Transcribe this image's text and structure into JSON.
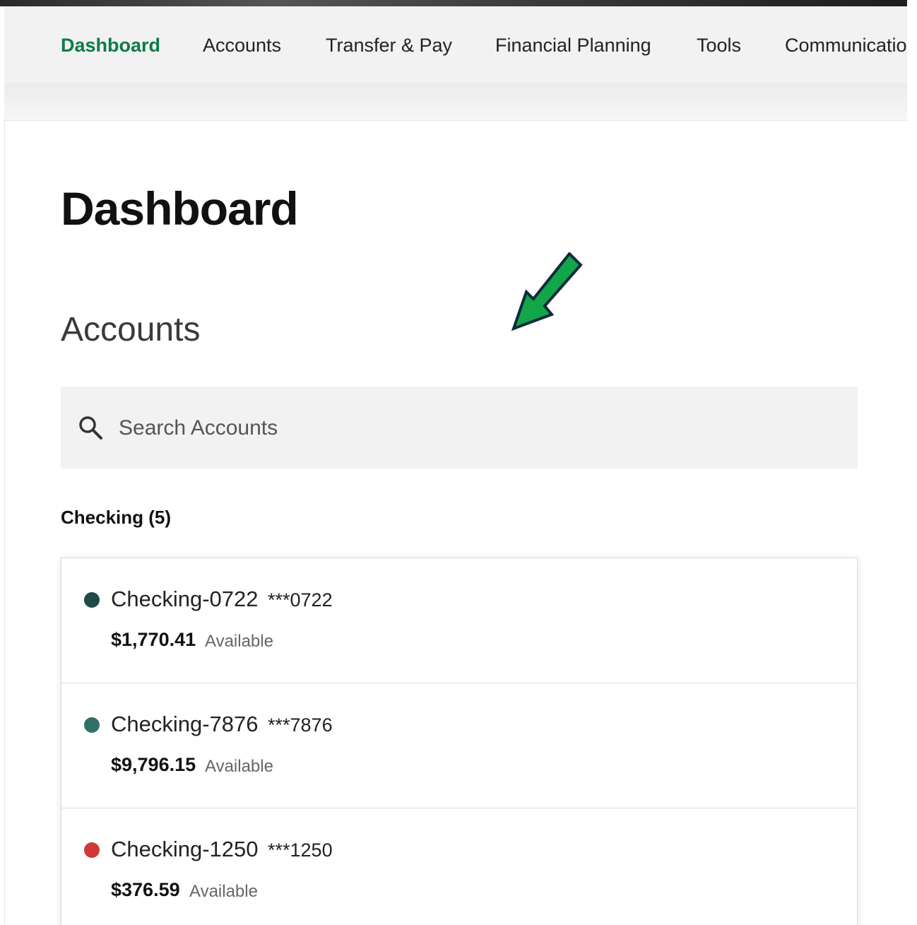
{
  "nav": {
    "items": [
      {
        "label": "Dashboard",
        "active": true
      },
      {
        "label": "Accounts",
        "active": false
      },
      {
        "label": "Transfer & Pay",
        "active": false
      },
      {
        "label": "Financial Planning",
        "active": false
      },
      {
        "label": "Tools",
        "active": false
      },
      {
        "label": "Communicatio",
        "active": false
      }
    ]
  },
  "page": {
    "title": "Dashboard",
    "section_title": "Accounts"
  },
  "search": {
    "placeholder": "Search Accounts",
    "value": ""
  },
  "checking": {
    "group_label": "Checking (5)",
    "available_label": "Available",
    "accounts": [
      {
        "name": "Checking-0722",
        "mask": "***0722",
        "balance": "$1,770.41",
        "dot_color": "#1f4a45"
      },
      {
        "name": "Checking-7876",
        "mask": "***7876",
        "balance": "$9,796.15",
        "dot_color": "#2f706b"
      },
      {
        "name": "Checking-1250",
        "mask": "***1250",
        "balance": "$376.59",
        "dot_color": "#d03a36"
      }
    ]
  },
  "colors": {
    "brand_green": "#0f7a4a",
    "arrow_green": "#12a54a",
    "arrow_outline": "#0e2a3e"
  }
}
